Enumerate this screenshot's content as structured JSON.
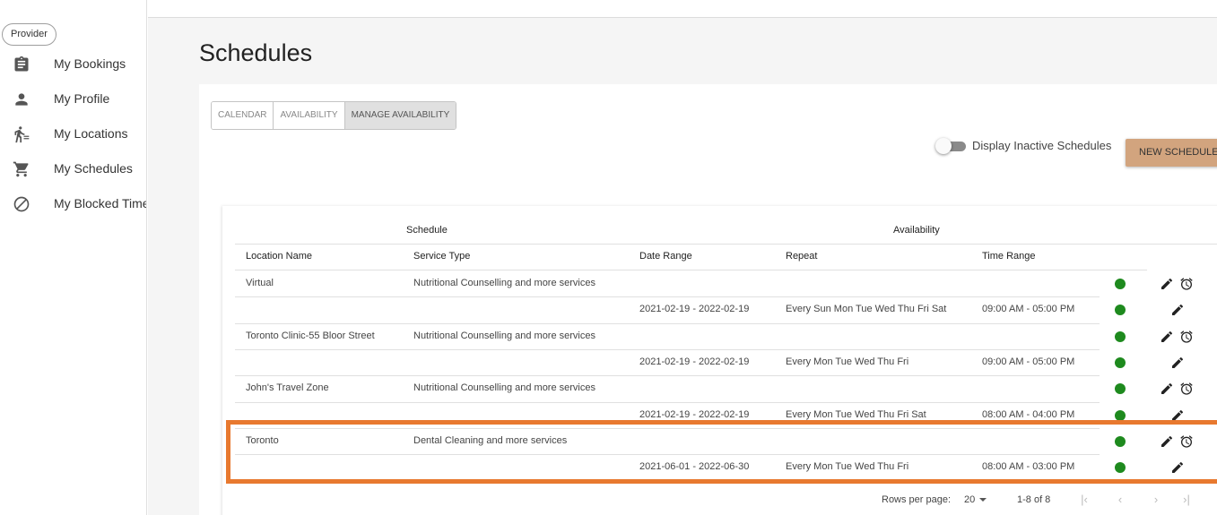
{
  "sidebar": {
    "role": "Provider",
    "items": [
      {
        "label": "My Bookings",
        "icon": "clipboard-icon"
      },
      {
        "label": "My Profile",
        "icon": "person-icon"
      },
      {
        "label": "My Locations",
        "icon": "walking-icon"
      },
      {
        "label": "My Schedules",
        "icon": "cart-icon"
      },
      {
        "label": "My Blocked Times",
        "icon": "block-icon"
      }
    ]
  },
  "page": {
    "title": "Schedules"
  },
  "tabs": [
    {
      "label": "CALENDAR",
      "active": false
    },
    {
      "label": "AVAILABILITY",
      "active": false
    },
    {
      "label": "MANAGE AVAILABILITY",
      "active": true
    }
  ],
  "controls": {
    "toggle_label": "Display Inactive Schedules",
    "toggle_on": false,
    "new_button": "NEW SCHEDULE"
  },
  "table": {
    "groups": {
      "schedule": "Schedule",
      "availability": "Availability"
    },
    "columns": {
      "location": "Location Name",
      "service": "Service Type",
      "date_range": "Date Range",
      "repeat": "Repeat",
      "time_range": "Time Range"
    },
    "rows": [
      {
        "location": "Virtual",
        "service": "Nutritional Counselling and more services",
        "date_range": "",
        "repeat": "",
        "time_range": "",
        "alarm": true
      },
      {
        "location": "",
        "service": "",
        "date_range": "2021-02-19 - 2022-02-19",
        "repeat": "Every Sun Mon Tue Wed Thu Fri Sat",
        "time_range": "09:00 AM - 05:00 PM",
        "alarm": false
      },
      {
        "location": "Toronto Clinic-55 Bloor Street",
        "service": "Nutritional Counselling and more services",
        "date_range": "",
        "repeat": "",
        "time_range": "",
        "alarm": true
      },
      {
        "location": "",
        "service": "",
        "date_range": "2021-02-19 - 2022-02-19",
        "repeat": "Every Mon Tue Wed Thu Fri",
        "time_range": "09:00 AM - 05:00 PM",
        "alarm": false
      },
      {
        "location": "John's Travel Zone",
        "service": "Nutritional Counselling and more services",
        "date_range": "",
        "repeat": "",
        "time_range": "",
        "alarm": true
      },
      {
        "location": "",
        "service": "",
        "date_range": "2021-02-19 - 2022-02-19",
        "repeat": "Every Mon Tue Wed Thu Fri Sat",
        "time_range": "08:00 AM - 04:00 PM",
        "alarm": false
      },
      {
        "location": "Toronto",
        "service": "Dental Cleaning and more services",
        "date_range": "",
        "repeat": "",
        "time_range": "",
        "alarm": true
      },
      {
        "location": "",
        "service": "",
        "date_range": "2021-06-01 - 2022-06-30",
        "repeat": "Every Mon Tue Wed Thu Fri",
        "time_range": "08:00 AM - 03:00 PM",
        "alarm": false
      }
    ],
    "status_color": "#1e8a1e"
  },
  "pagination": {
    "rows_per_page_label": "Rows per page:",
    "rows_per_page": "20",
    "range": "1-8 of 8"
  },
  "highlight_color": "#e8792f"
}
